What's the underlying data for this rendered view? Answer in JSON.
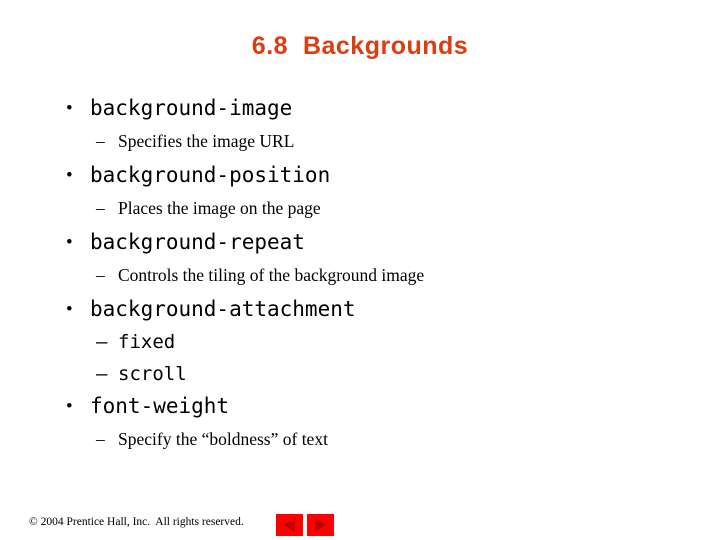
{
  "slide": {
    "title": "6.8  Backgrounds",
    "title_color": "#dd3c10",
    "background_color": "#ffffff",
    "bullet_glyph": "•",
    "dash_glyph": "–",
    "items": [
      {
        "label": "background-image",
        "sub": [
          {
            "label": "Specifies the image URL",
            "style": "serif"
          }
        ]
      },
      {
        "label": "background-position",
        "sub": [
          {
            "label": "Places the image on the page",
            "style": "serif"
          }
        ]
      },
      {
        "label": "background-repeat",
        "sub": [
          {
            "label": "Controls the tiling of the background image",
            "style": "serif"
          }
        ]
      },
      {
        "label": "background-attachment",
        "sub": [
          {
            "label": "fixed",
            "style": "mono"
          },
          {
            "label": "scroll",
            "style": "mono"
          }
        ]
      },
      {
        "label": "font-weight",
        "sub": [
          {
            "label": "Specify the “boldness” of text",
            "style": "serif"
          }
        ]
      }
    ]
  },
  "footer": {
    "copyright": "© 2004 Prentice Hall, Inc.  All rights reserved.",
    "nav": {
      "previous_icon": "triangle-left-icon",
      "next_icon": "triangle-right-icon",
      "button_color": "#fe0000",
      "triangle_color": "#c00000"
    }
  }
}
